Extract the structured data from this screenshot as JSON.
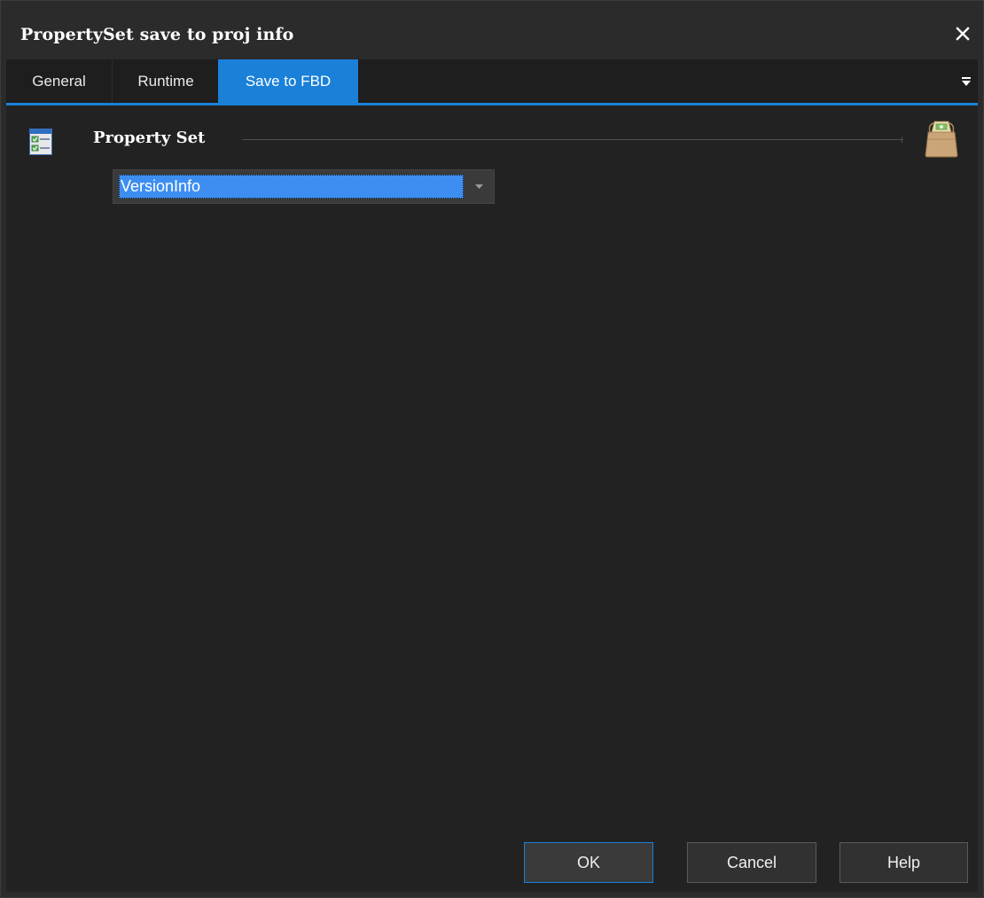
{
  "window": {
    "title": "PropertySet save to proj info"
  },
  "tabs": [
    {
      "label": "General",
      "active": false
    },
    {
      "label": "Runtime",
      "active": false
    },
    {
      "label": "Save to FBD",
      "active": true
    }
  ],
  "property_set": {
    "label": "Property Set",
    "selected_value": "VersionInfo"
  },
  "buttons": {
    "ok": "OK",
    "cancel": "Cancel",
    "help": "Help"
  },
  "colors": {
    "accent": "#1a80d8",
    "selection": "#3d8ef0",
    "background": "#222222"
  },
  "icons": {
    "close": "close-icon",
    "tab_menu": "menu-icon",
    "group": "property-list-icon",
    "action": "bag-icon",
    "dropdown": "chevron-down-icon"
  }
}
